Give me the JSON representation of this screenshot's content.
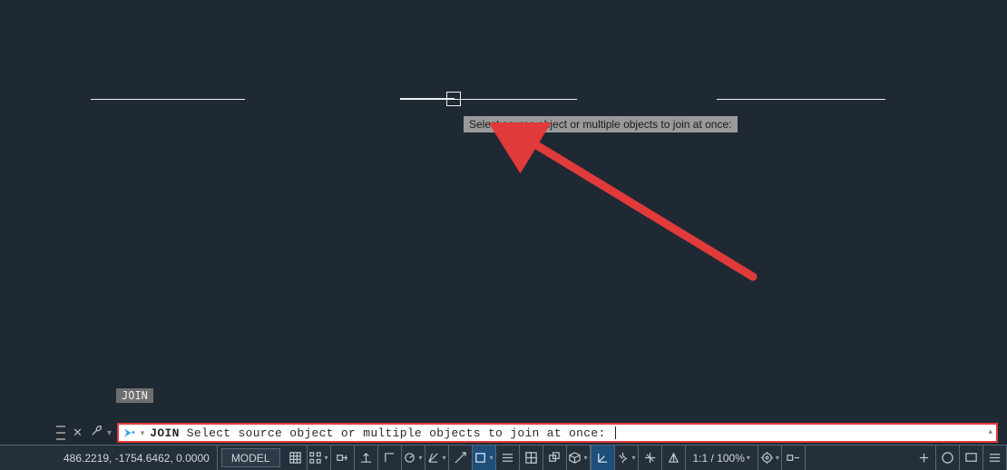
{
  "canvas": {
    "tooltip": "Select source object or multiple objects to join at once:"
  },
  "recent_command": "JOIN",
  "command_line": {
    "command": "JOIN",
    "prompt": "Select source object or multiple objects to join at once:"
  },
  "status": {
    "coords": "486.2219, -1754.6462, 0.0000",
    "space_button": "MODEL",
    "zoom": "1:1 / 100%"
  },
  "annotation": {
    "type": "arrow",
    "color": "#e03a3a"
  }
}
